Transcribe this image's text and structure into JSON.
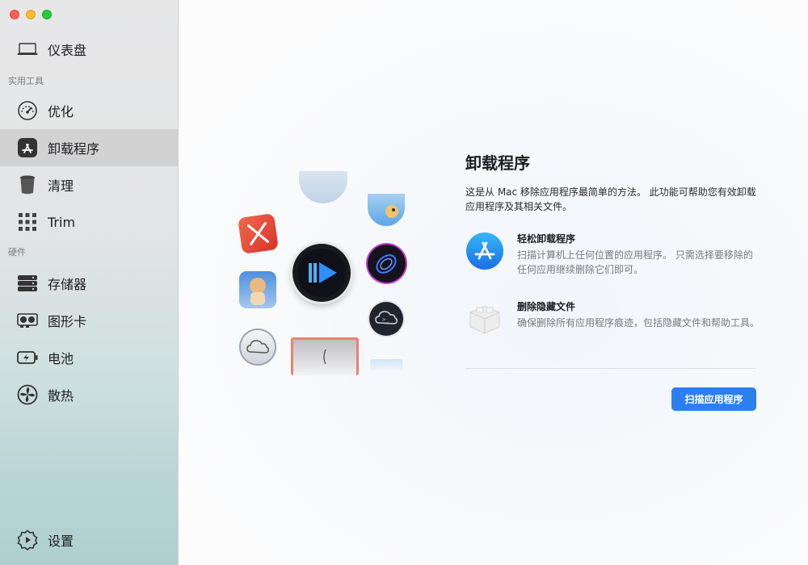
{
  "sidebar": {
    "dashboard": "仪表盘",
    "section_utilities": "实用工具",
    "optimize": "优化",
    "uninstall": "卸载程序",
    "clean": "清理",
    "trim": "Trim",
    "section_hardware": "硬件",
    "storage": "存储器",
    "graphics": "图形卡",
    "battery": "电池",
    "cooling": "散热",
    "settings": "设置"
  },
  "main": {
    "title": "卸载程序",
    "description": "这是从 Mac 移除应用程序最简单的方法。 此功能可帮助您有效卸载应用程序及其相关文件。",
    "features": [
      {
        "title": "轻松卸载程序",
        "text": "扫描计算机上任何位置的应用程序。 只需选择要移除的任何应用继续删除它们即可。"
      },
      {
        "title": "删除隐藏文件",
        "text": "确保删除所有应用程序痕迹，包括隐藏文件和帮助工具。"
      }
    ],
    "scan_button": "扫描应用程序"
  },
  "colors": {
    "accent": "#2c7ff0",
    "active_nav": "#d2d2d3"
  }
}
